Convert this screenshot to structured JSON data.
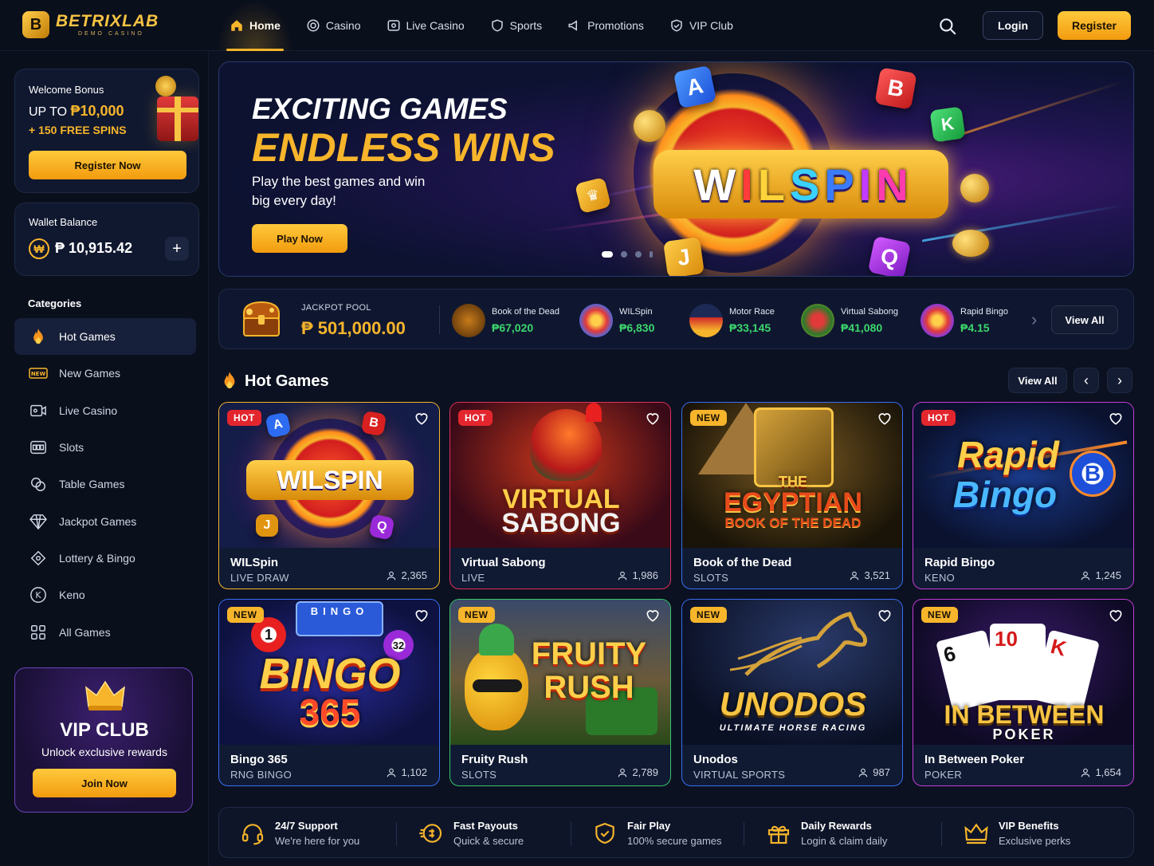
{
  "brand": {
    "name": "BETRIXLAB",
    "tagline": "DEMO CASINO",
    "logo_letter": "B"
  },
  "nav": [
    {
      "label": "Home",
      "icon": "home-icon",
      "active": true
    },
    {
      "label": "Casino",
      "icon": "casino-chip-icon"
    },
    {
      "label": "Live Casino",
      "icon": "live-casino-icon"
    },
    {
      "label": "Sports",
      "icon": "sports-icon"
    },
    {
      "label": "Promotions",
      "icon": "megaphone-icon"
    },
    {
      "label": "VIP Club",
      "icon": "vip-shield-icon"
    }
  ],
  "header": {
    "login": "Login",
    "register": "Register"
  },
  "bonus": {
    "title": "Welcome Bonus",
    "prefix": "UP TO ",
    "amount": "₱10,000",
    "spins": "+ 150 FREE SPINS",
    "button": "Register Now"
  },
  "wallet": {
    "title": "Wallet Balance",
    "currency_icon": "₩",
    "amount": "₱ 10,915.42",
    "add": "+"
  },
  "categories": {
    "title": "Categories",
    "items": [
      {
        "label": "Hot Games",
        "icon": "fire-icon",
        "active": true
      },
      {
        "label": "New Games",
        "icon": "new-tag-icon"
      },
      {
        "label": "Live Casino",
        "icon": "video-camera-icon"
      },
      {
        "label": "Slots",
        "icon": "slot-machine-icon"
      },
      {
        "label": "Table Games",
        "icon": "poker-chips-icon"
      },
      {
        "label": "Jackpot Games",
        "icon": "diamond-icon"
      },
      {
        "label": "Lottery & Bingo",
        "icon": "ticket-icon"
      },
      {
        "label": "Keno",
        "icon": "keno-k-icon"
      },
      {
        "label": "All Games",
        "icon": "grid-icon"
      }
    ]
  },
  "vip": {
    "title": "VIP CLUB",
    "subtitle": "Unlock exclusive rewards",
    "button": "Join Now"
  },
  "hero": {
    "line1": "EXCITING GAMES",
    "line2": "ENDLESS WINS",
    "desc": "Play the best games and win big every day!",
    "button": "Play Now",
    "logo_letters": [
      "W",
      "I",
      "L",
      "S",
      "P",
      "I",
      "N"
    ],
    "slides": 4,
    "active_slide": 0
  },
  "jackpot": {
    "label": "JACKPOT POOL",
    "value": "₱ 501,000.00",
    "items": [
      {
        "name": "Book of the Dead",
        "amount": "₱67,020"
      },
      {
        "name": "WILSpin",
        "amount": "₱6,830"
      },
      {
        "name": "Motor Race",
        "amount": "₱33,145"
      },
      {
        "name": "Virtual Sabong",
        "amount": "₱41,080"
      },
      {
        "name": "Rapid Bingo",
        "amount": "₱4.15"
      }
    ],
    "view_all": "View All"
  },
  "section": {
    "title": "Hot Games",
    "view_all": "View All"
  },
  "games": [
    {
      "badge": "HOT",
      "title": "WILSpin",
      "category": "LIVE DRAW",
      "players": "2,365",
      "art": "WILSPIN",
      "border": "#f7b52b"
    },
    {
      "badge": "HOT",
      "title": "Virtual Sabong",
      "category": "LIVE",
      "players": "1,986",
      "art_l1": "VIRTUAL",
      "art_l2": "SABONG",
      "border": "#e0305a"
    },
    {
      "badge": "NEW",
      "title": "Book of the Dead",
      "category": "SLOTS",
      "players": "3,521",
      "art_l1": "THE",
      "art_l2": "EGYPTIAN",
      "art_l3": "BOOK OF THE DEAD",
      "border": "#3a6ef5"
    },
    {
      "badge": "HOT",
      "title": "Rapid Bingo",
      "category": "KENO",
      "players": "1,245",
      "art_l1": "Rapid",
      "art_l2": "Bingo",
      "art_badge": "B",
      "border": "#c53cd8"
    },
    {
      "badge": "NEW",
      "title": "Bingo 365",
      "category": "RNG BINGO",
      "players": "1,102",
      "art_l1": "BINGO",
      "art_l2": "365",
      "art_board": "BINGO",
      "border": "#3a6ef5"
    },
    {
      "badge": "NEW",
      "title": "Fruity Rush",
      "category": "SLOTS",
      "players": "2,789",
      "art_l1": "FRUITY",
      "art_l2": "RUSH",
      "border": "#37c46b"
    },
    {
      "badge": "NEW",
      "title": "Unodos",
      "category": "VIRTUAL SPORTS",
      "players": "987",
      "art_l1": "UNODOS",
      "art_l2": "ULTIMATE HORSE RACING",
      "border": "#3a6ef5"
    },
    {
      "badge": "NEW",
      "title": "In Between Poker",
      "category": "POKER",
      "players": "1,654",
      "art_l1": "IN BETWEEN",
      "art_l2": "POKER",
      "cards": [
        "6",
        "10",
        "K"
      ],
      "border": "#c53cd8"
    }
  ],
  "features": [
    {
      "title": "24/7 Support",
      "sub": "We're here for you",
      "icon": "headset-icon"
    },
    {
      "title": "Fast Payouts",
      "sub": "Quick & secure",
      "icon": "fast-coin-icon"
    },
    {
      "title": "Fair Play",
      "sub": "100% secure games",
      "icon": "shield-check-icon"
    },
    {
      "title": "Daily Rewards",
      "sub": "Login & claim daily",
      "icon": "gift-icon"
    },
    {
      "title": "VIP Benefits",
      "sub": "Exclusive perks",
      "icon": "crown-icon"
    }
  ]
}
